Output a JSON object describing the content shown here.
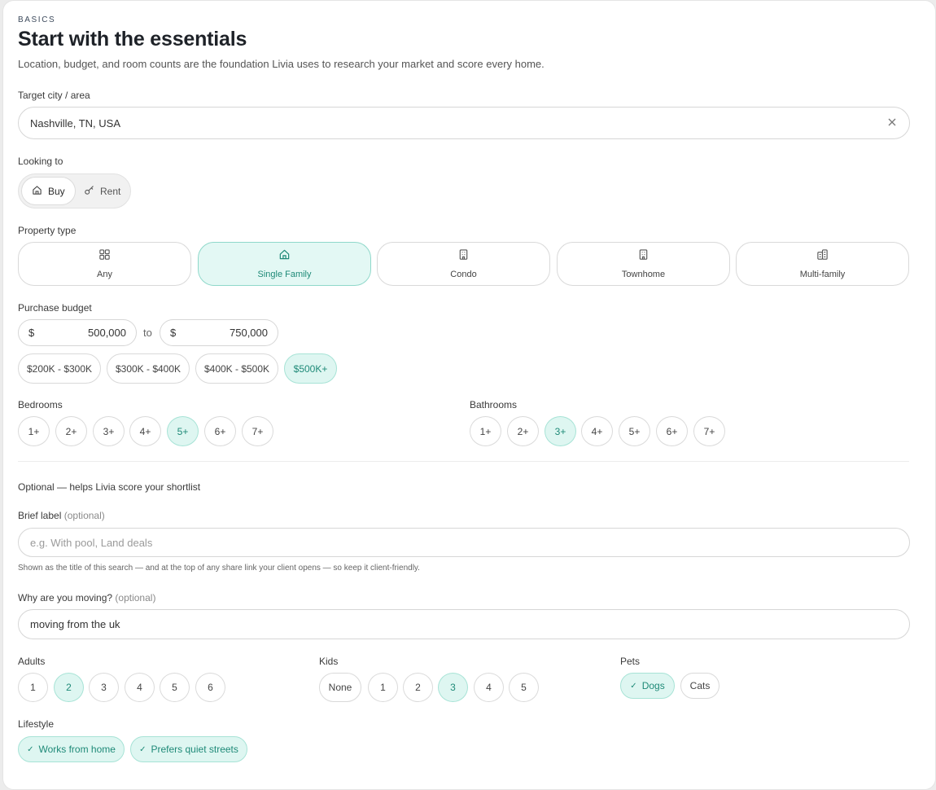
{
  "header": {
    "eyebrow": "BASICS",
    "title": "Start with the essentials",
    "subtitle": "Location, budget, and room counts are the foundation Livia uses to research your market and score every home."
  },
  "location": {
    "label": "Target city / area",
    "value": "Nashville, TN, USA",
    "clear_icon": "close-icon"
  },
  "looking_to": {
    "label": "Looking to",
    "options": [
      {
        "label": "Buy",
        "icon": "home-icon",
        "selected": true
      },
      {
        "label": "Rent",
        "icon": "key-icon",
        "selected": false
      }
    ]
  },
  "property_type": {
    "label": "Property type",
    "options": [
      {
        "label": "Any",
        "icon": "grid-icon",
        "selected": false
      },
      {
        "label": "Single Family",
        "icon": "home-icon",
        "selected": true
      },
      {
        "label": "Condo",
        "icon": "building-icon",
        "selected": false
      },
      {
        "label": "Townhome",
        "icon": "building-icon",
        "selected": false
      },
      {
        "label": "Multi-family",
        "icon": "buildings-icon",
        "selected": false
      }
    ]
  },
  "budget": {
    "label": "Purchase budget",
    "currency": "$",
    "min": "500,000",
    "separator": "to",
    "max": "750,000",
    "presets": [
      {
        "label": "$200K - $300K",
        "selected": false
      },
      {
        "label": "$300K - $400K",
        "selected": false
      },
      {
        "label": "$400K - $500K",
        "selected": false
      },
      {
        "label": "$500K+",
        "selected": true
      }
    ]
  },
  "bedrooms": {
    "label": "Bedrooms",
    "options": [
      "1+",
      "2+",
      "3+",
      "4+",
      "5+",
      "6+",
      "7+"
    ],
    "selected": "5+"
  },
  "bathrooms": {
    "label": "Bathrooms",
    "options": [
      "1+",
      "2+",
      "3+",
      "4+",
      "5+",
      "6+",
      "7+"
    ],
    "selected": "3+"
  },
  "optional": {
    "heading": "Optional — helps Livia score your shortlist",
    "brief_label": "Brief label",
    "optional_tag": "(optional)",
    "brief_placeholder": "e.g. With pool, Land deals",
    "brief_hint": "Shown as the title of this search — and at the top of any share link your client opens — so keep it client-friendly.",
    "why_label": "Why are you moving?",
    "why_value": "moving from the uk"
  },
  "adults": {
    "label": "Adults",
    "options": [
      "1",
      "2",
      "3",
      "4",
      "5",
      "6"
    ],
    "selected": "2"
  },
  "kids": {
    "label": "Kids",
    "options": [
      "None",
      "1",
      "2",
      "3",
      "4",
      "5"
    ],
    "selected": "3"
  },
  "pets": {
    "label": "Pets",
    "options": [
      {
        "label": "Dogs",
        "selected": true
      },
      {
        "label": "Cats",
        "selected": false
      }
    ]
  },
  "lifestyle": {
    "label": "Lifestyle",
    "options": [
      {
        "label": "Works from home",
        "selected": true
      },
      {
        "label": "Prefers quiet streets",
        "selected": true
      }
    ]
  },
  "colors": {
    "accent": "#1f8a78",
    "accent_bg": "#def6f1",
    "accent_border": "#a7e3d6"
  }
}
